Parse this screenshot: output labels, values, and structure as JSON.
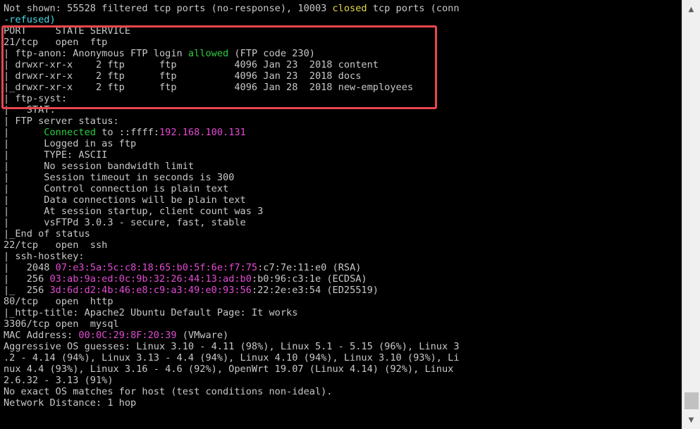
{
  "terminal": {
    "lines": [
      [
        {
          "t": "Not shown: 55528 filtered tcp ports (no-response), 10003 "
        },
        {
          "t": "closed",
          "c": "yellow"
        },
        {
          "t": " tcp ports (conn"
        }
      ],
      [
        {
          "t": "-refused)",
          "c": "cyan"
        }
      ],
      [
        {
          "t": "PORT     STATE SERVICE"
        }
      ],
      [
        {
          "t": "21/tcp   open  ftp"
        }
      ],
      [
        {
          "t": "| ftp-anon: Anonymous FTP login "
        },
        {
          "t": "allowed",
          "c": "green"
        },
        {
          "t": " (FTP code 230)"
        }
      ],
      [
        {
          "t": "| drwxr-xr-x    2 ftp      ftp          4096 Jan 23  2018 content"
        }
      ],
      [
        {
          "t": "| drwxr-xr-x    2 ftp      ftp          4096 Jan 23  2018 docs"
        }
      ],
      [
        {
          "t": "|_drwxr-xr-x    2 ftp      ftp          4096 Jan 28  2018 new-employees"
        }
      ],
      [
        {
          "t": "| ftp-syst:"
        }
      ],
      [
        {
          "t": "|   STAT:"
        }
      ],
      [
        {
          "t": "| FTP server status:"
        }
      ],
      [
        {
          "t": "|      "
        },
        {
          "t": "Connected",
          "c": "green"
        },
        {
          "t": " to ::ffff:"
        },
        {
          "t": "192.168.100.131",
          "c": "magenta"
        }
      ],
      [
        {
          "t": "|      Logged in as ftp"
        }
      ],
      [
        {
          "t": "|      TYPE: ASCII"
        }
      ],
      [
        {
          "t": "|      No session bandwidth limit"
        }
      ],
      [
        {
          "t": "|      Session timeout in seconds is 300"
        }
      ],
      [
        {
          "t": "|      Control connection is plain text"
        }
      ],
      [
        {
          "t": "|      Data connections will be plain text"
        }
      ],
      [
        {
          "t": "|      At session startup, client count was 3"
        }
      ],
      [
        {
          "t": "|      vsFTPd 3.0.3 - secure, fast, stable"
        }
      ],
      [
        {
          "t": "|_End of status"
        }
      ],
      [
        {
          "t": "22/tcp   open  ssh"
        }
      ],
      [
        {
          "t": "| ssh-hostkey:"
        }
      ],
      [
        {
          "t": "|   2048 "
        },
        {
          "t": "07:e3:5a:5c:c8:18:65:b0:5f:6e:f7:75",
          "c": "magenta"
        },
        {
          "t": ":c7:7e:11:e0 (RSA)"
        }
      ],
      [
        {
          "t": "|   256 "
        },
        {
          "t": "03:ab:9a:ed:0c:9b:32:26:44:13:ad:b0",
          "c": "magenta"
        },
        {
          "t": ":b0:96:c3:1e (ECDSA)"
        }
      ],
      [
        {
          "t": "|_  256 "
        },
        {
          "t": "3d:6d:d2:4b:46:e8:c9:a3:49:e0:93:56",
          "c": "magenta"
        },
        {
          "t": ":22:2e:e3:54 (ED25519)"
        }
      ],
      [
        {
          "t": "80/tcp   open  http"
        }
      ],
      [
        {
          "t": "|_http-title: Apache2 Ubuntu Default Page: It works"
        }
      ],
      [
        {
          "t": "3306/tcp open  mysql"
        }
      ],
      [
        {
          "t": "MAC Address: "
        },
        {
          "t": "00:0C:29:8F:20:39",
          "c": "magenta"
        },
        {
          "t": " (VMware)"
        }
      ],
      [
        {
          "t": "Aggressive OS guesses: Linux 3.10 - 4.11 (98%), Linux 5.1 - 5.15 (96%), Linux 3"
        }
      ],
      [
        {
          "t": ".2 - 4.14 (94%), Linux 3.13 - 4.4 (94%), Linux 4.10 (94%), Linux 3.10 (93%), Li"
        }
      ],
      [
        {
          "t": "nux 4.4 (93%), Linux 3.16 - 4.6 (92%), OpenWrt 19.07 (Linux 4.14) (92%), Linux"
        }
      ],
      [
        {
          "t": "2.6.32 - 3.13 (91%)"
        }
      ],
      [
        {
          "t": "No exact OS matches for host (test conditions non-ideal)."
        }
      ],
      [
        {
          "t": "Network Distance: 1 hop"
        }
      ]
    ]
  },
  "scrollbar": {
    "up_icon": "▲",
    "down_icon": "▼"
  },
  "highlight": {
    "color": "#e8474d"
  }
}
